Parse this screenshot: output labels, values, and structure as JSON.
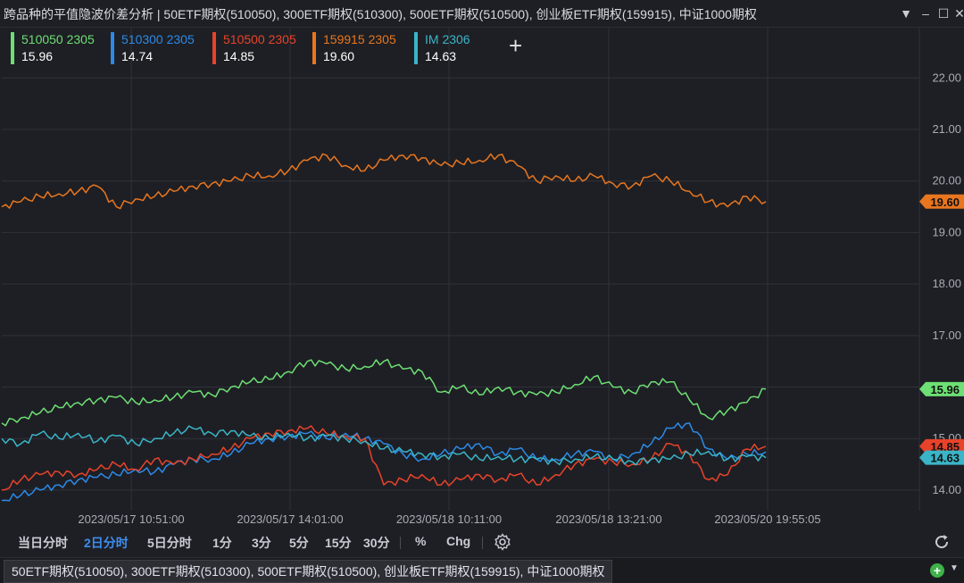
{
  "window": {
    "title": "跨品种的平值隐波价差分析 | 50ETF期权(510050), 300ETF期权(510300), 500ETF期权(510500), 创业板ETF期权(159915), 中证1000期权",
    "controls": [
      "▼",
      "–",
      "☐",
      "✕"
    ]
  },
  "legend": {
    "items": [
      {
        "name": "510050 2305",
        "value": "15.96",
        "color": "#6ddf74"
      },
      {
        "name": "510300 2305",
        "value": "14.74",
        "color": "#2c8ae8"
      },
      {
        "name": "510500 2305",
        "value": "14.85",
        "color": "#e8432a"
      },
      {
        "name": "159915 2305",
        "value": "19.60",
        "color": "#e8761f"
      },
      {
        "name": "IM 2306",
        "value": "14.63",
        "color": "#3ab5c8"
      }
    ],
    "add_symbol": "+"
  },
  "chart_data": {
    "type": "line",
    "y_ticks": [
      "22.00",
      "21.00",
      "20.00",
      "19.00",
      "18.00",
      "17.00",
      "16.00",
      "15.00",
      "14.00"
    ],
    "ylim": [
      13.6,
      22.3
    ],
    "x_ticks": [
      "2023/05/17 10:51:00",
      "2023/05/17 14:01:00",
      "2023/05/18 10:11:00",
      "2023/05/18 13:21:00",
      "2023/05/20 19:55:05"
    ],
    "grid": true,
    "legend_position": "top-left",
    "price_tags": [
      {
        "label": "19.60",
        "value": 19.6,
        "color": "#e8761f"
      },
      {
        "label": "15.96",
        "value": 15.96,
        "color": "#6ddf74"
      },
      {
        "label": "14.85",
        "value": 14.85,
        "color": "#e8432a"
      },
      {
        "label": "14.63",
        "value": 14.63,
        "color": "#3ab5c8"
      }
    ],
    "series": [
      {
        "name": "510050 2305",
        "color": "#6ddf74",
        "values": [
          15.3,
          15.4,
          15.5,
          15.6,
          15.7,
          15.75,
          15.8,
          15.7,
          15.75,
          15.8,
          15.9,
          15.85,
          16.0,
          16.1,
          16.15,
          16.3,
          16.5,
          16.45,
          16.35,
          16.4,
          16.5,
          16.35,
          16.3,
          15.9,
          16.0,
          15.85,
          16.0,
          15.9,
          15.85,
          15.9,
          16.05,
          16.2,
          16.0,
          15.9,
          16.1,
          16.1,
          15.75,
          15.4,
          15.55,
          15.7,
          15.96
        ]
      },
      {
        "name": "510300 2305",
        "color": "#2c8ae8",
        "values": [
          13.8,
          13.9,
          14.0,
          14.1,
          14.2,
          14.25,
          14.3,
          14.4,
          14.35,
          14.5,
          14.6,
          14.6,
          14.7,
          14.9,
          15.0,
          15.05,
          15.1,
          15.0,
          15.1,
          15.0,
          14.9,
          14.7,
          14.6,
          14.7,
          14.8,
          14.9,
          14.7,
          14.8,
          14.6,
          14.6,
          14.7,
          14.75,
          14.6,
          14.7,
          14.9,
          15.2,
          15.3,
          14.8,
          14.6,
          14.7,
          14.74
        ]
      },
      {
        "name": "510500 2305",
        "color": "#e8432a",
        "values": [
          14.0,
          14.2,
          14.3,
          14.35,
          14.3,
          14.4,
          14.5,
          14.4,
          14.6,
          14.5,
          14.6,
          14.7,
          14.8,
          15.0,
          15.1,
          15.15,
          15.2,
          15.1,
          15.05,
          15.0,
          14.1,
          14.2,
          14.3,
          14.1,
          14.2,
          14.3,
          14.2,
          14.3,
          14.1,
          14.3,
          14.5,
          14.6,
          14.55,
          14.5,
          14.6,
          14.9,
          14.7,
          14.2,
          14.3,
          14.8,
          14.85
        ]
      },
      {
        "name": "159915 2305",
        "color": "#e8761f",
        "values": [
          19.5,
          19.6,
          19.7,
          19.75,
          19.8,
          19.9,
          19.5,
          19.65,
          19.7,
          19.8,
          19.9,
          19.95,
          20.0,
          20.1,
          20.1,
          20.2,
          20.4,
          20.5,
          20.3,
          20.2,
          20.4,
          20.5,
          20.45,
          20.3,
          20.35,
          20.4,
          20.5,
          20.3,
          20.0,
          20.1,
          20.0,
          20.1,
          19.95,
          19.9,
          20.1,
          20.0,
          19.8,
          19.6,
          19.5,
          19.7,
          19.6
        ]
      },
      {
        "name": "IM 2306",
        "color": "#3ab5c8",
        "values": [
          15.0,
          14.9,
          15.1,
          15.0,
          15.1,
          14.95,
          15.05,
          14.9,
          15.0,
          15.1,
          15.2,
          15.1,
          15.15,
          15.05,
          15.0,
          15.1,
          15.0,
          15.05,
          15.0,
          14.95,
          14.8,
          14.75,
          14.7,
          14.65,
          14.7,
          14.6,
          14.65,
          14.6,
          14.6,
          14.55,
          14.6,
          14.65,
          14.6,
          14.55,
          14.6,
          14.6,
          14.7,
          14.75,
          14.6,
          14.65,
          14.63
        ]
      }
    ]
  },
  "toolbar": {
    "periods": [
      "当日分时",
      "2日分时",
      "5日分时",
      "1分",
      "3分",
      "5分",
      "15分",
      "30分"
    ],
    "active": "2日分时",
    "percent": "%",
    "chg": "Chg",
    "settings_icon": "gear-icon",
    "refresh_icon": "refresh-icon"
  },
  "tab": {
    "label": "50ETF期权(510050), 300ETF期权(510300), 500ETF期权(510500), 创业板ETF期权(159915), 中证1000期权"
  }
}
